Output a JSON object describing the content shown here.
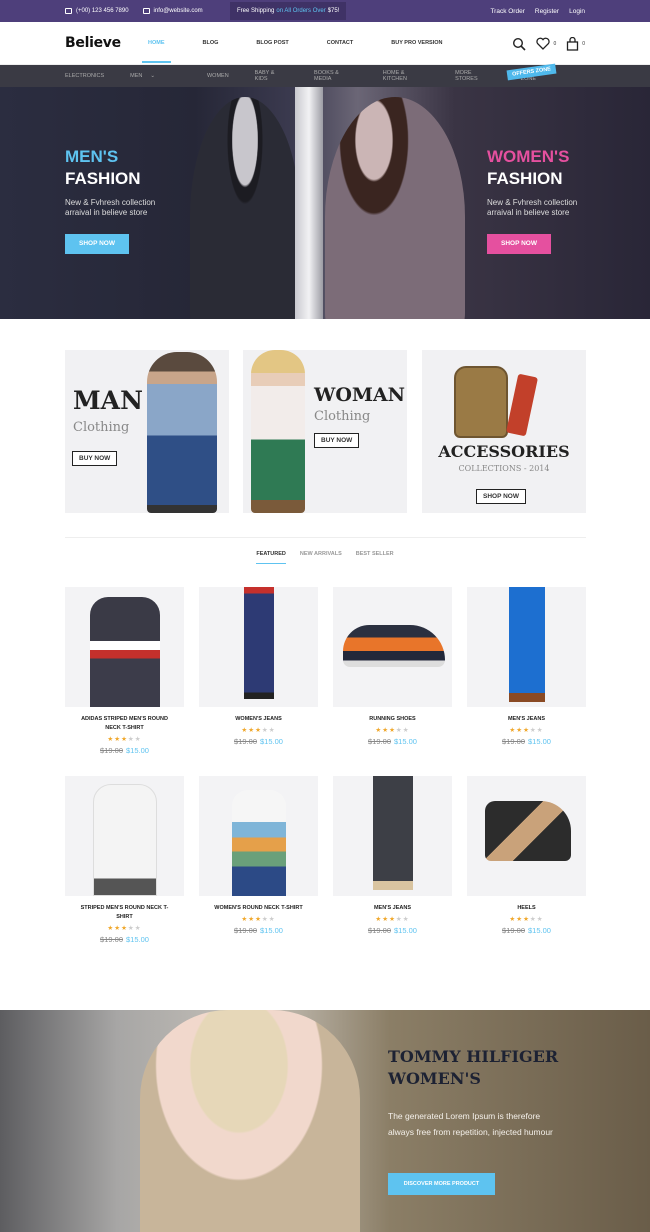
{
  "topbar": {
    "phone": "(+00) 123 456 7890",
    "email": "info@website.com",
    "shipping_pre": "Free Shipping",
    "shipping_hl": "on All Orders Over",
    "shipping_amt": "$75!",
    "track": "Track Order",
    "register": "Register",
    "login": "Login"
  },
  "header": {
    "logo": "Believe",
    "nav": [
      "HOME",
      "BLOG",
      "BLOG POST",
      "CONTACT",
      "BUY PRO VERSION"
    ],
    "wishlist_count": "0",
    "cart_count": "0"
  },
  "categories": [
    "ELECTRONICS",
    "MEN",
    "WOMEN",
    "BABY & KIDS",
    "BOOKS & MEDIA",
    "HOME & KITCHEN",
    "MORE STORES",
    "OFFERS ZONE"
  ],
  "offers_badge": "OFFERS ZONE",
  "hero": {
    "left": {
      "title1": "MEN'S",
      "title2": "FASHION",
      "text1": "New & Fvhresh collection",
      "text2": "arraival in believe store",
      "button": "SHOP NOW"
    },
    "right": {
      "title1": "WOMEN'S",
      "title2": "FASHION",
      "text1": "New & Fvhresh collection",
      "text2": "arraival in believe store",
      "button": "SHOP NOW"
    }
  },
  "banners": [
    {
      "title": "MAN",
      "subtitle": "Clothing",
      "button": "BUY NOW"
    },
    {
      "title": "WOMAN",
      "subtitle": "Clothing",
      "button": "BUY NOW"
    },
    {
      "title": "ACCESSORIES",
      "subtitle": "COLLECTIONS - 2014",
      "button": "SHOP NOW"
    }
  ],
  "tabs": [
    "FEATURED",
    "NEW ARRIVALS",
    "BEST SELLER"
  ],
  "products": [
    {
      "name": "ADIDAS STRIPED MEN'S ROUND NECK T-SHIRT",
      "old": "$19.00",
      "new": "$15.00",
      "rating": 3
    },
    {
      "name": "WOMEN'S JEANS",
      "old": "$19.00",
      "new": "$15.00",
      "rating": 3
    },
    {
      "name": "RUNNING SHOES",
      "old": "$19.00",
      "new": "$15.00",
      "rating": 3
    },
    {
      "name": "MEN'S JEANS",
      "old": "$19.00",
      "new": "$15.00",
      "rating": 3
    },
    {
      "name": "STRIPED MEN'S ROUND NECK T-SHIRT",
      "old": "$19.00",
      "new": "$15.00",
      "rating": 3
    },
    {
      "name": "WOMEN'S ROUND NECK T-SHIRT",
      "old": "$19.00",
      "new": "$15.00",
      "rating": 3
    },
    {
      "name": "MEN'S JEANS",
      "old": "$19.00",
      "new": "$15.00",
      "rating": 3
    },
    {
      "name": "HEELS",
      "old": "$19.00",
      "new": "$15.00",
      "rating": 3
    }
  ],
  "promo": {
    "title1": "TOMMY HILFIGER",
    "title2": "WOMEN'S",
    "text": "The generated Lorem Ipsum is therefore always free from repetition, injected humour",
    "button": "DISCOVER MORE PRODUCT"
  },
  "colors": {
    "accent": "#5ec3f0",
    "pink": "#e5509f",
    "topbar": "#4e3f7b"
  }
}
